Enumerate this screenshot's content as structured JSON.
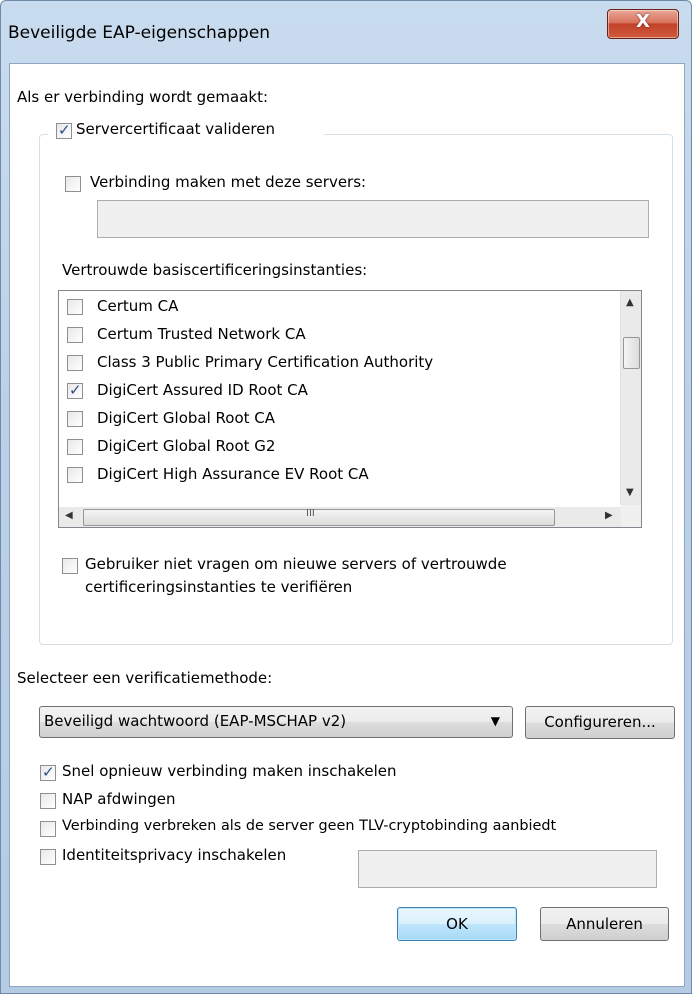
{
  "window": {
    "title": "Beveiligde EAP-eigenschappen",
    "close_glyph": "X"
  },
  "connect_label": "Als er verbinding wordt gemaakt:",
  "validate_cert": {
    "label": "Servercertificaat valideren",
    "checked": true
  },
  "connect_servers": {
    "label": "Verbinding maken met deze servers:",
    "checked": false,
    "value": ""
  },
  "trusted_label": "Vertrouwde basiscertificeringsinstanties:",
  "cert_list": [
    {
      "label": "Certum CA",
      "checked": false
    },
    {
      "label": "Certum Trusted Network CA",
      "checked": false
    },
    {
      "label": "Class 3 Public Primary Certification Authority",
      "checked": false
    },
    {
      "label": "DigiCert Assured ID Root CA",
      "checked": true
    },
    {
      "label": "DigiCert Global Root CA",
      "checked": false
    },
    {
      "label": "DigiCert Global Root G2",
      "checked": false
    },
    {
      "label": "DigiCert High Assurance EV Root CA",
      "checked": false
    }
  ],
  "scroll": {
    "up": "▲",
    "down": "▼",
    "left": "◀",
    "right": "▶",
    "grip": "III"
  },
  "no_prompt": {
    "line1": "Gebruiker niet vragen om nieuwe servers of vertrouwde",
    "line2": "certificeringsinstanties te verifiëren",
    "checked": false
  },
  "method_label": "Selecteer een verificatiemethode:",
  "method_select": {
    "value": "Beveiligd wachtwoord (EAP-MSCHAP v2)",
    "caret": "▼"
  },
  "configure_button": "Configureren...",
  "options": {
    "fast_reconnect": {
      "label": "Snel opnieuw verbinding maken inschakelen",
      "checked": true
    },
    "nap": {
      "label": "NAP afdwingen",
      "checked": false
    },
    "tlv": {
      "label": "Verbinding verbreken als de server geen TLV-cryptobinding aanbiedt",
      "checked": false
    },
    "identity_privacy": {
      "label": "Identiteitsprivacy inschakelen",
      "checked": false,
      "value": ""
    }
  },
  "ok_button": "OK",
  "cancel_button": "Annuleren",
  "check_glyph": "✓"
}
